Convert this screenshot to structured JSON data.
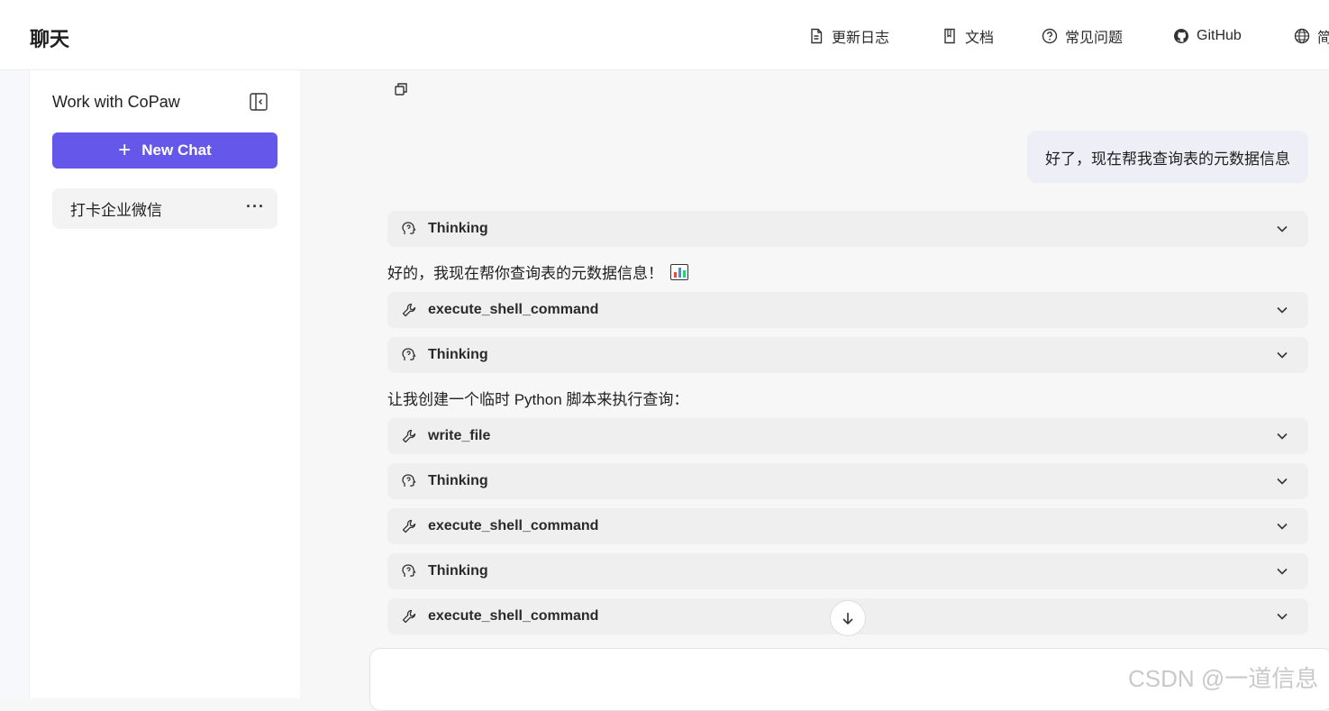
{
  "header": {
    "title": "聊天",
    "nav": [
      {
        "label": "更新日志",
        "icon": "document-icon"
      },
      {
        "label": "文档",
        "icon": "book-icon"
      },
      {
        "label": "常见问题",
        "icon": "question-circle-icon"
      },
      {
        "label": "GitHub",
        "icon": "github-icon"
      },
      {
        "label": "简",
        "icon": "globe-icon"
      }
    ]
  },
  "sidebar": {
    "title": "Work with CoPaw",
    "new_chat_label": "New Chat",
    "sessions": [
      {
        "label": "打卡企业微信",
        "more": "···"
      }
    ]
  },
  "chat": {
    "user_message": "好了，现在帮我查询表的元数据信息",
    "blocks": [
      {
        "type": "thinking",
        "label": "Thinking"
      },
      {
        "type": "text",
        "label": "好的，我现在帮你查询表的元数据信息！"
      },
      {
        "type": "tool",
        "label": "execute_shell_command"
      },
      {
        "type": "thinking",
        "label": "Thinking"
      },
      {
        "type": "text",
        "label": "让我创建一个临时 Python 脚本来执行查询："
      },
      {
        "type": "tool",
        "label": "write_file"
      },
      {
        "type": "thinking",
        "label": "Thinking"
      },
      {
        "type": "tool",
        "label": "execute_shell_command"
      },
      {
        "type": "thinking",
        "label": "Thinking"
      },
      {
        "type": "tool",
        "label": "execute_shell_command"
      }
    ]
  },
  "colors": {
    "accent": "#6457ea",
    "user_bubble": "#eeeef6",
    "block_bg": "#efefef"
  },
  "watermark": "CSDN @一道信息"
}
